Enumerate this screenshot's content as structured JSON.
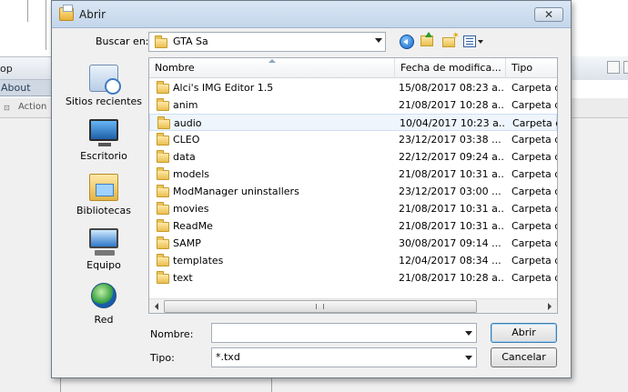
{
  "background_app": {
    "menu_fragment": "op",
    "about_label": "About",
    "action_label": "Action"
  },
  "dialog": {
    "title": "Abrir",
    "close_glyph": "✕",
    "look_in_label": "Buscar en:",
    "look_in_value": "GTA Sa",
    "places": [
      {
        "label": "Sitios recientes",
        "icon": "recent-places-icon"
      },
      {
        "label": "Escritorio",
        "icon": "desktop-icon"
      },
      {
        "label": "Bibliotecas",
        "icon": "libraries-icon"
      },
      {
        "label": "Equipo",
        "icon": "computer-icon"
      },
      {
        "label": "Red",
        "icon": "network-icon"
      }
    ],
    "columns": {
      "name": "Nombre",
      "date": "Fecha de modifica...",
      "type": "Tipo"
    },
    "files": [
      {
        "name": "Alci's IMG Editor 1.5",
        "date": "15/08/2017 08:23 a...",
        "type": "Carpeta d"
      },
      {
        "name": "anim",
        "date": "21/08/2017 10:28 a...",
        "type": "Carpeta d"
      },
      {
        "name": "audio",
        "date": "10/04/2017 10:23 a...",
        "type": "Carpeta d"
      },
      {
        "name": "CLEO",
        "date": "23/12/2017 03:38 ...",
        "type": "Carpeta d"
      },
      {
        "name": "data",
        "date": "22/12/2017 09:24 a...",
        "type": "Carpeta d"
      },
      {
        "name": "models",
        "date": "21/08/2017 10:31 a...",
        "type": "Carpeta d"
      },
      {
        "name": "ModManager uninstallers",
        "date": "23/12/2017 03:00 ...",
        "type": "Carpeta d"
      },
      {
        "name": "movies",
        "date": "21/08/2017 10:31 a...",
        "type": "Carpeta d"
      },
      {
        "name": "ReadMe",
        "date": "21/08/2017 10:31 a...",
        "type": "Carpeta d"
      },
      {
        "name": "SAMP",
        "date": "30/08/2017 09:14 ...",
        "type": "Carpeta d"
      },
      {
        "name": "templates",
        "date": "12/04/2017 08:34 ...",
        "type": "Carpeta d"
      },
      {
        "name": "text",
        "date": "21/08/2017 10:28 a...",
        "type": "Carpeta d"
      }
    ],
    "hovered_row": 2,
    "filename_label": "Nombre:",
    "filename_value": "",
    "filetype_label": "Tipo:",
    "filetype_value": "*.txd",
    "open_button": "Abrir",
    "cancel_button": "Cancelar"
  }
}
